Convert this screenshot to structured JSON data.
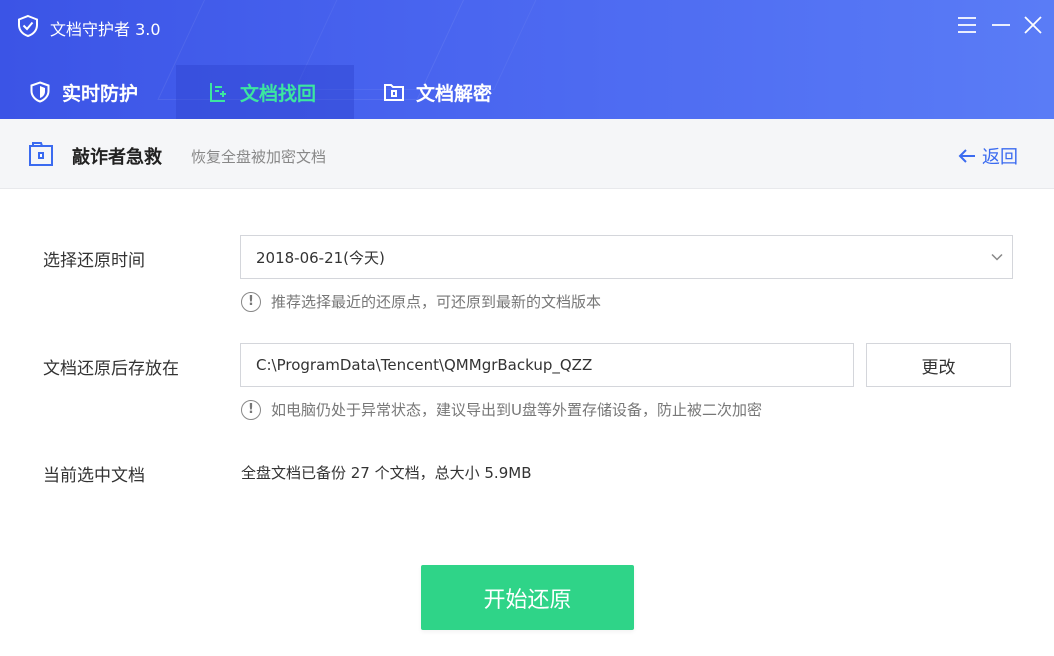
{
  "app": {
    "title": "文档守护者 3.0"
  },
  "window_controls": {
    "menu_icon": "menu-icon",
    "minimize_icon": "minimize-icon",
    "close_icon": "close-icon"
  },
  "tabs": [
    {
      "label": "实时防护",
      "icon": "shield-icon",
      "active": false
    },
    {
      "label": "文档找回",
      "icon": "document-restore-icon",
      "active": true
    },
    {
      "label": "文档解密",
      "icon": "folder-lock-icon",
      "active": false
    }
  ],
  "subheader": {
    "title": "敲诈者急救",
    "description": "恢复全盘被加密文档",
    "back_label": "返回",
    "icon": "lock-box-icon"
  },
  "form": {
    "restore_time": {
      "label": "选择还原时间",
      "value": "2018-06-21(今天)",
      "hint": "推荐选择最近的还原点，可还原到最新的文档版本"
    },
    "save_location": {
      "label": "文档还原后存放在",
      "value": "C:\\ProgramData\\Tencent\\QMMgrBackup_QZZ",
      "button_label": "更改",
      "hint": "如电脑仍处于异常状态，建议导出到U盘等外置存储设备，防止被二次加密"
    },
    "selected_docs": {
      "label": "当前选中文档",
      "value": "全盘文档已备份 27 个文档，总大小 5.9MB"
    }
  },
  "actions": {
    "start_label": "开始还原"
  },
  "colors": {
    "header_start": "#3b54e6",
    "header_end": "#5a7cf6",
    "active_tab_text": "#3ce6a0",
    "primary_button": "#2fd488",
    "link": "#3b6bf0"
  }
}
